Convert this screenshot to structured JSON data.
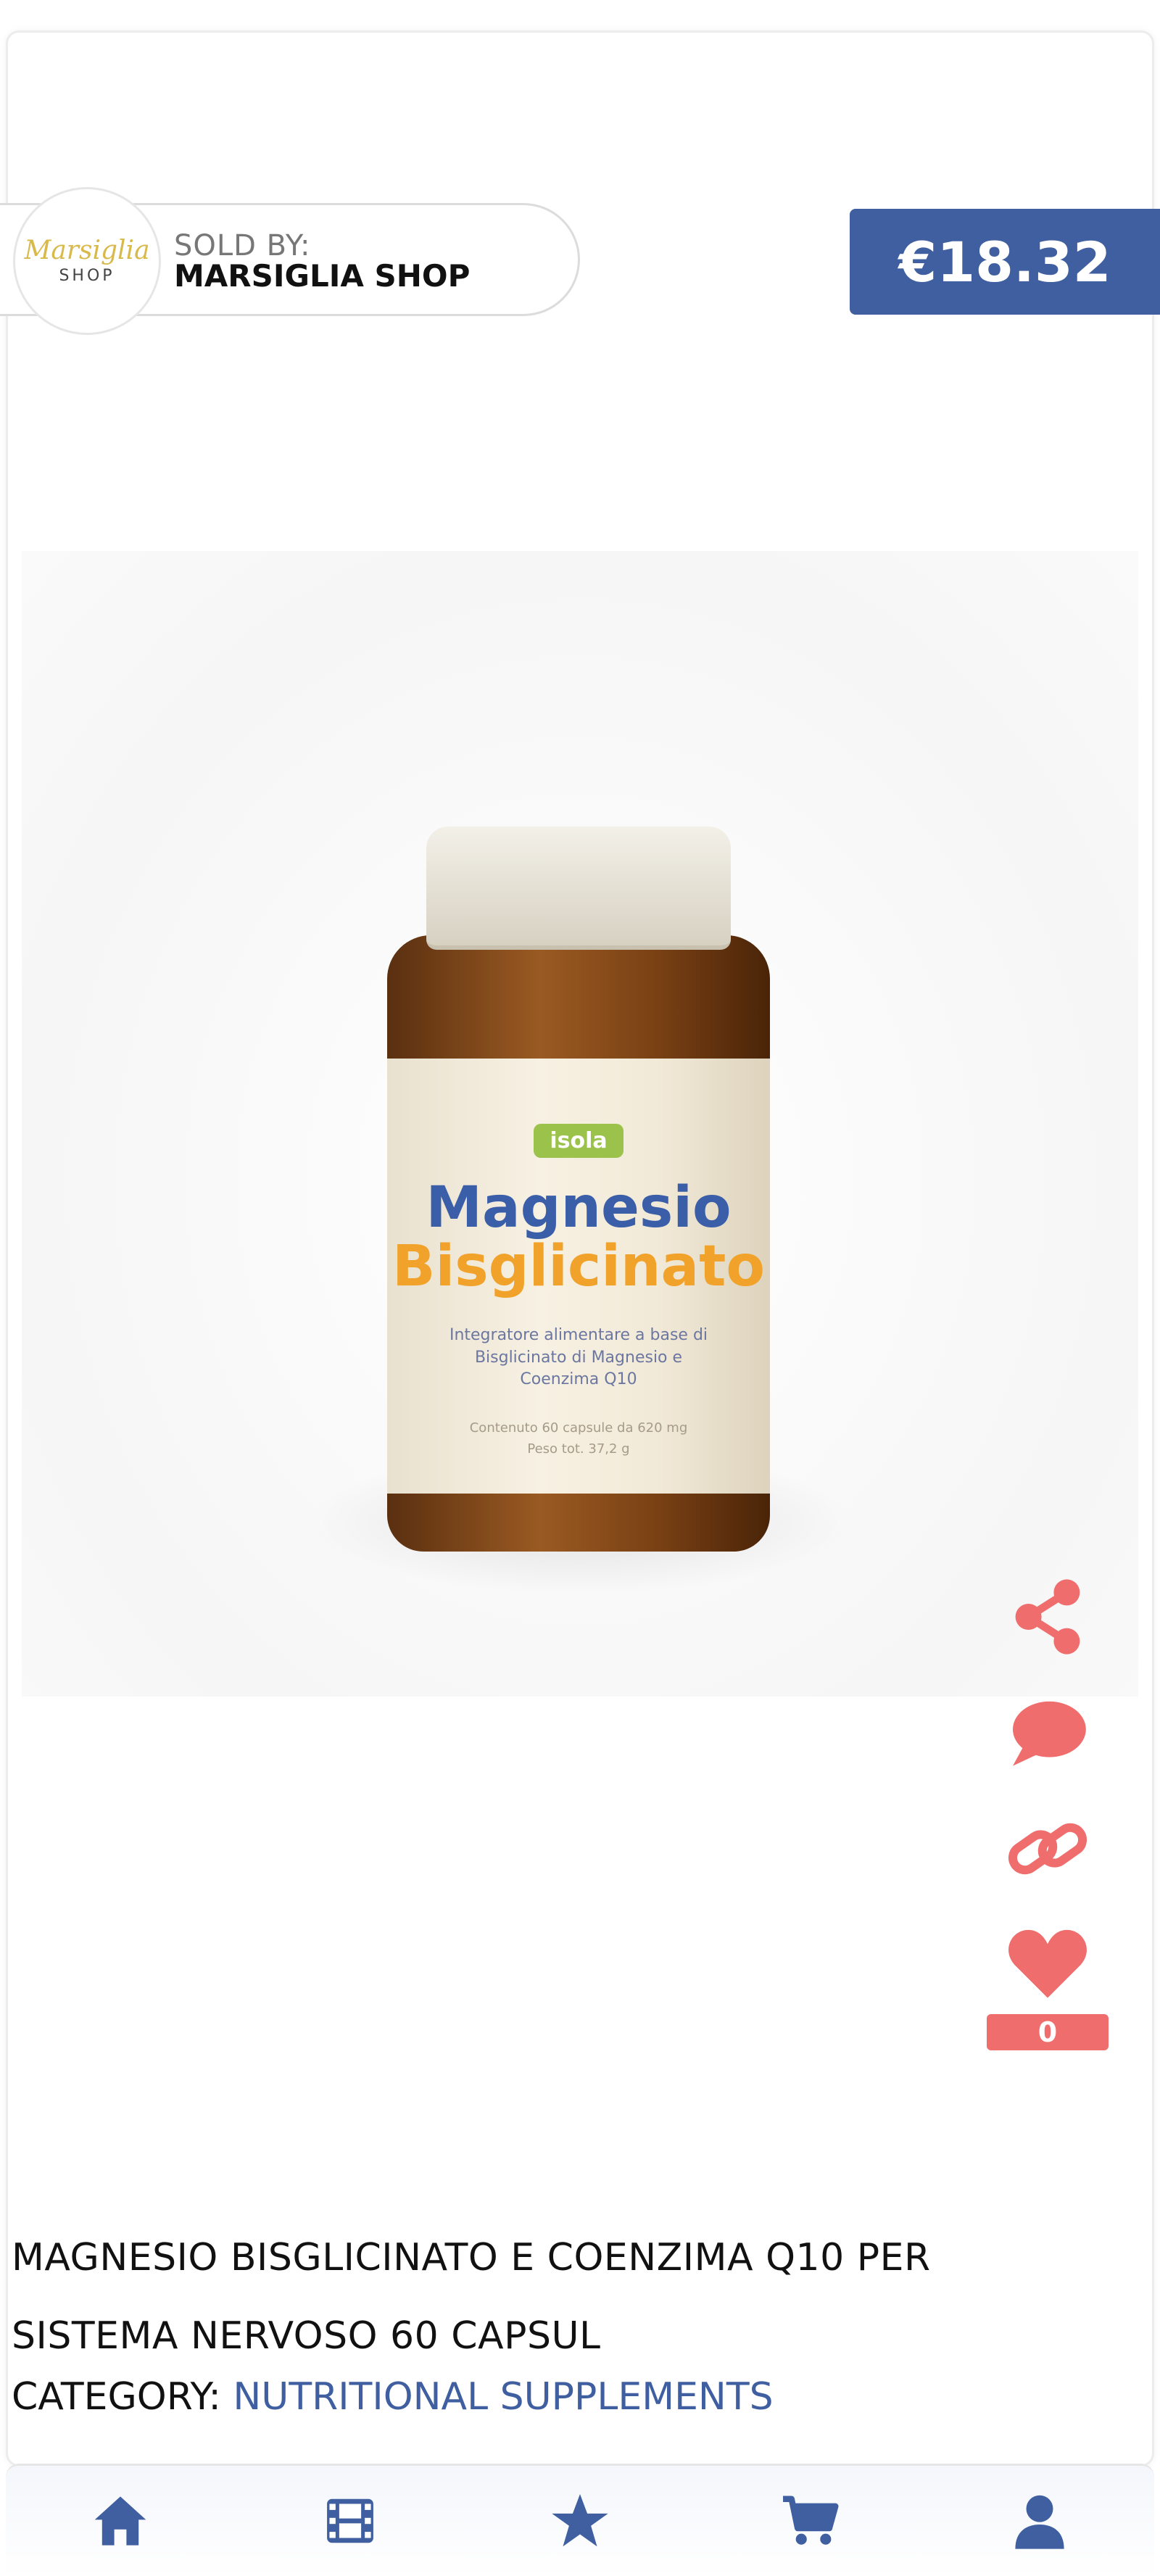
{
  "seller": {
    "sold_by_label": "SOLD BY:",
    "name": "MARSIGLIA SHOP",
    "logo_script": "Marsiglia",
    "logo_shop": "SHOP"
  },
  "price": "€18.32",
  "product_image": {
    "brand": "isola",
    "title_line1": "Magnesio",
    "title_line2": "Bisglicinato",
    "description": "Integratore alimentare a base di Bisglicinato di Magnesio e Coenzima Q10",
    "contents": "Contenuto 60 capsule da 620 mg",
    "weight": "Peso tot. 37,2 g"
  },
  "actions": {
    "likes_count": "0",
    "icons": [
      "share-icon",
      "comment-icon",
      "link-icon",
      "heart-icon"
    ]
  },
  "product": {
    "title": "MAGNESIO BISGLICINATO E COENZIMA Q10 PER SISTEMA NERVOSO 60 CAPSUL",
    "category_label": "CATEGORY:",
    "category_value": "NUTRITIONAL SUPPLEMENTS"
  },
  "colors": {
    "brand_blue": "#3f5fa0",
    "accent_red": "#f06d6d"
  },
  "bottom_nav": {
    "icons": [
      "home-icon",
      "film-icon",
      "star-icon",
      "cart-icon",
      "user-icon"
    ]
  }
}
